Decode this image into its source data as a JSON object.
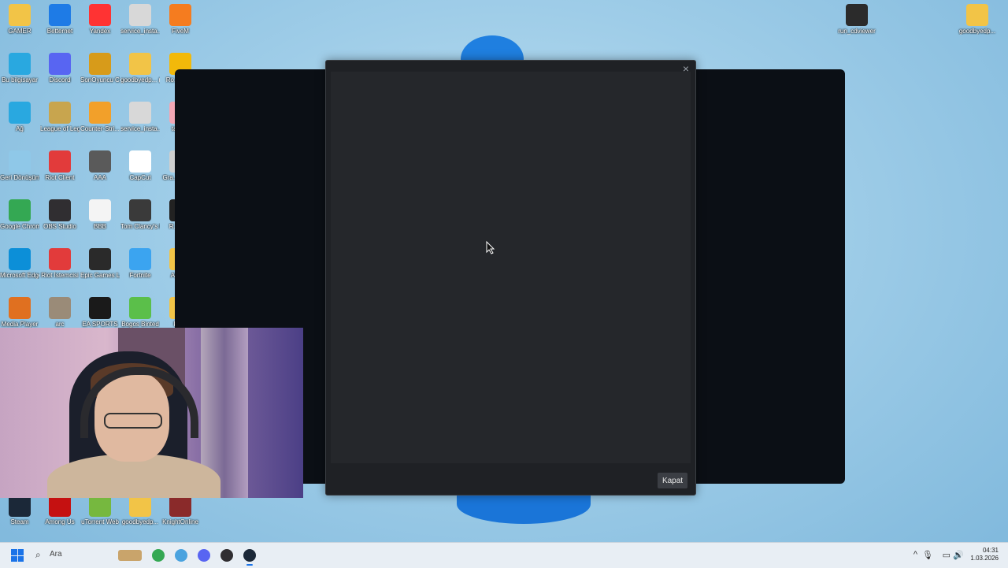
{
  "desktop": {
    "icons": [
      {
        "label": "GAMER",
        "icon": "folder-icon",
        "color": "#f2c447",
        "col": 0,
        "row": 0
      },
      {
        "label": "Betternet",
        "icon": "shield-icon",
        "color": "#1e7be6",
        "col": 1,
        "row": 0
      },
      {
        "label": "Yandex",
        "icon": "yandex-icon",
        "color": "#ff3333",
        "col": 2,
        "row": 0
      },
      {
        "label": "service_insta...",
        "icon": "settings-file-icon",
        "color": "#d8d8d8",
        "col": 3,
        "row": 0
      },
      {
        "label": "FiveM",
        "icon": "fivem-icon",
        "color": "#f57c1f",
        "col": 4,
        "row": 0
      },
      {
        "label": "Bu bilgisayar",
        "icon": "monitor-icon",
        "color": "#29a8e0",
        "col": 0,
        "row": 1
      },
      {
        "label": "Discord",
        "icon": "discord-icon",
        "color": "#5865f2",
        "col": 1,
        "row": 1
      },
      {
        "label": "SonOyuncu Client",
        "icon": "sonoyuncu-icon",
        "color": "#d79b1a",
        "col": 2,
        "row": 1
      },
      {
        "label": "goodbyedp... (1)",
        "icon": "folder-icon",
        "color": "#f2c447",
        "col": 3,
        "row": 1
      },
      {
        "label": "Ro... Ga...",
        "icon": "rockstar-icon",
        "color": "#f2b90a",
        "col": 4,
        "row": 1
      },
      {
        "label": "Ağ",
        "icon": "network-icon",
        "color": "#29a8e0",
        "col": 0,
        "row": 2
      },
      {
        "label": "League of Legends",
        "icon": "lol-icon",
        "color": "#c8a54e",
        "col": 1,
        "row": 2
      },
      {
        "label": "Counter-Stri... 2",
        "icon": "cs2-icon",
        "color": "#f2a02a",
        "col": 2,
        "row": 2
      },
      {
        "label": "service_insta...",
        "icon": "settings-file-icon",
        "color": "#d8d8d8",
        "col": 3,
        "row": 2
      },
      {
        "label": "taed...",
        "icon": "file-icon",
        "color": "#f3a7b5",
        "col": 4,
        "row": 2
      },
      {
        "label": "Geri Dönüşüm...",
        "icon": "recycle-bin-icon",
        "color": "#8fc8e8",
        "col": 0,
        "row": 3
      },
      {
        "label": "Riot Client",
        "icon": "riot-icon",
        "color": "#e23b3b",
        "col": 1,
        "row": 3
      },
      {
        "label": "AAA",
        "icon": "document-icon",
        "color": "#5a5a5a",
        "col": 2,
        "row": 3
      },
      {
        "label": "CapCut",
        "icon": "capcut-icon",
        "color": "#ffffff",
        "col": 3,
        "row": 3
      },
      {
        "label": "Gra... Auto...",
        "icon": "gta-icon",
        "color": "#cfcfcf",
        "col": 4,
        "row": 3
      },
      {
        "label": "Google Chrome",
        "icon": "chrome-icon",
        "color": "#34a853",
        "col": 0,
        "row": 4
      },
      {
        "label": "OBS Studio",
        "icon": "obs-icon",
        "color": "#302e31",
        "col": 1,
        "row": 4
      },
      {
        "label": "BBB",
        "icon": "document-icon",
        "color": "#f4f4f4",
        "col": 2,
        "row": 4
      },
      {
        "label": "Tom Clancy's Rainbow Six...",
        "icon": "r6-icon",
        "color": "#3a3a3a",
        "col": 3,
        "row": 4
      },
      {
        "label": "R... Si...",
        "icon": "app-icon",
        "color": "#222222",
        "col": 4,
        "row": 4
      },
      {
        "label": "Microsoft Edge",
        "icon": "edge-icon",
        "color": "#0c8fd8",
        "col": 0,
        "row": 5
      },
      {
        "label": "Riot İstemcisi",
        "icon": "riot-icon",
        "color": "#e23b3b",
        "col": 1,
        "row": 5
      },
      {
        "label": "Epic Games Launcher",
        "icon": "epic-icon",
        "color": "#2a2a2a",
        "col": 2,
        "row": 5
      },
      {
        "label": "Fortnite",
        "icon": "fortnite-icon",
        "color": "#3ba4f0",
        "col": 3,
        "row": 5
      },
      {
        "label": "Asse...",
        "icon": "folder-icon",
        "color": "#f2c447",
        "col": 4,
        "row": 5
      },
      {
        "label": "Media Player",
        "icon": "media-player-icon",
        "color": "#e07020",
        "col": 0,
        "row": 6
      },
      {
        "label": "arc",
        "icon": "app-icon",
        "color": "#9a8b78",
        "col": 1,
        "row": 6
      },
      {
        "label": "EA SPORTS",
        "icon": "ea-icon",
        "color": "#1a1a1a",
        "col": 2,
        "row": 6
      },
      {
        "label": "Bogos Binted",
        "icon": "alien-icon",
        "color": "#5bbf4a",
        "col": 3,
        "row": 6
      },
      {
        "label": "FU...",
        "icon": "folder-icon",
        "color": "#f2c447",
        "col": 4,
        "row": 6
      }
    ],
    "right_icons": [
      {
        "label": "run_cdviewer",
        "icon": "cdviewer-icon",
        "color": "#2b2b2b"
      },
      {
        "label": "goodbyedp...",
        "icon": "folder-icon",
        "color": "#f2c447"
      }
    ],
    "bottom_icons": [
      {
        "label": "Steam",
        "icon": "steam-icon",
        "color": "#1b2838"
      },
      {
        "label": "Among Us",
        "icon": "among-us-icon",
        "color": "#c51111"
      },
      {
        "label": "uTorrent Web",
        "icon": "utorrent-icon",
        "color": "#76b83f"
      },
      {
        "label": "goodbyedp...",
        "icon": "folder-icon",
        "color": "#f2c447"
      },
      {
        "label": "KnightOnline",
        "icon": "knight-online-icon",
        "color": "#8a2a2a"
      }
    ]
  },
  "dialog": {
    "close_symbol": "×",
    "close_button_label": "Kapat"
  },
  "taskbar": {
    "search_placeholder": "Ara",
    "apps": [
      {
        "name": "chrome-taskbar-icon",
        "color": "#34a853"
      },
      {
        "name": "settings-taskbar-icon",
        "color": "#4aa3df"
      },
      {
        "name": "discord-taskbar-icon",
        "color": "#5865f2"
      },
      {
        "name": "obs-taskbar-icon",
        "color": "#302e31"
      },
      {
        "name": "steam-taskbar-icon",
        "color": "#1b2838"
      }
    ],
    "tray": {
      "chevron": "^",
      "mic": "🎙",
      "network": "▭",
      "volume": "🔊"
    },
    "clock": {
      "time": "04:31",
      "date": "1.03.2026"
    }
  }
}
